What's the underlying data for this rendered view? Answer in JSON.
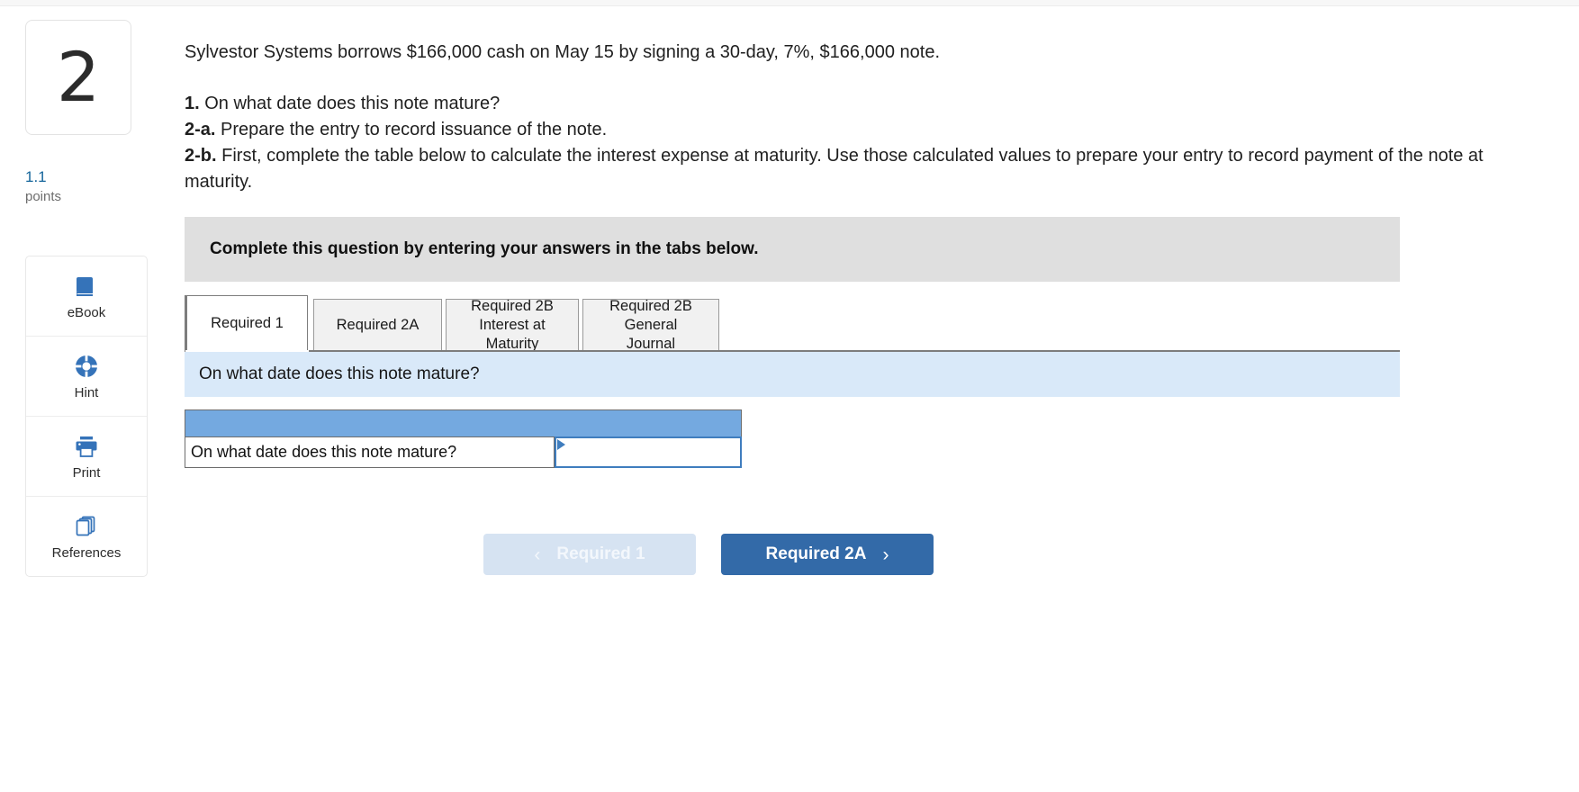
{
  "question": {
    "number": "2",
    "points_value": "1.1",
    "points_label": "points",
    "stem": "Sylvestor Systems borrows $166,000 cash on May 15 by signing a 30-day, 7%, $166,000 note.",
    "requirements": [
      {
        "marker": "1.",
        "text": " On what date does this note mature?"
      },
      {
        "marker": "2-a.",
        "text": " Prepare the entry to record issuance of the note."
      },
      {
        "marker": "2-b.",
        "text": " First, complete the table below to calculate the interest expense at maturity. Use those calculated values to prepare your entry to record payment of the note at maturity."
      }
    ]
  },
  "tools": [
    {
      "label": "eBook",
      "icon": "ebook-icon"
    },
    {
      "label": "Hint",
      "icon": "lifebuoy-icon"
    },
    {
      "label": "Print",
      "icon": "printer-icon"
    },
    {
      "label": "References",
      "icon": "pages-stack-icon"
    }
  ],
  "instruction_banner": {
    "text": "Complete this question by entering your answers in the tabs below."
  },
  "tabs": [
    {
      "label": "Required 1",
      "active": true
    },
    {
      "label": "Required 2A",
      "active": false
    },
    {
      "label": "Required 2B Interest at Maturity",
      "line1": "Required 2B",
      "line2": "Interest at",
      "line3": "Maturity",
      "active": false
    },
    {
      "label": "Required 2B General Journal",
      "line1": "Required 2B",
      "line2": "General",
      "line3": "Journal",
      "active": false
    }
  ],
  "question_bar": {
    "text": "On what date does this note mature?"
  },
  "answer_table": {
    "header_blank": "",
    "rows": [
      {
        "label": "On what date does this note mature?",
        "value": "",
        "placeholder": ""
      }
    ]
  },
  "navigation": {
    "prev_label": "Required 1",
    "prev_chevron": "‹",
    "next_label": "Required 2A",
    "next_chevron": "›"
  },
  "colors": {
    "accent_blue": "#336aa8",
    "table_header_blue": "#74a9e0",
    "info_bar_blue": "#d9e9f9",
    "banner_gray": "#dfdfdf",
    "points_blue": "#15659b",
    "input_border_blue": "#3f7dbe",
    "prev_button_bg": "#d6e3f2"
  }
}
